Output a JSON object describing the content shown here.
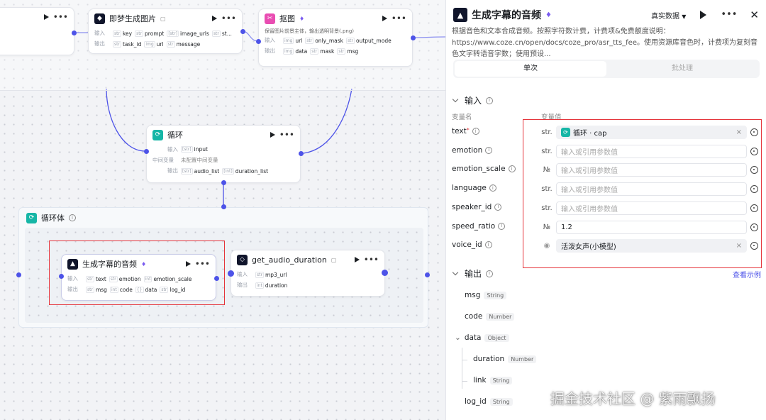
{
  "canvas": {
    "node_top_left": {},
    "node_jimeng": {
      "title": "即梦生成图片",
      "in_label": "输入",
      "out_label": "输出",
      "inputs": [
        {
          "t": "str",
          "n": "key"
        },
        {
          "t": "str",
          "n": "prompt"
        },
        {
          "t": "[str]",
          "n": "image_urls"
        },
        {
          "t": "str",
          "n": "st..."
        }
      ],
      "outputs": [
        {
          "t": "str",
          "n": "task_id"
        },
        {
          "t": "img",
          "n": "url"
        },
        {
          "t": "str",
          "n": "message"
        }
      ]
    },
    "node_koutu": {
      "title": "抠图",
      "desc": "保留图片前景主体，输出透明背景(.png)",
      "in_label": "输入",
      "out_label": "输出",
      "inputs": [
        {
          "t": "img",
          "n": "url"
        },
        {
          "t": "str",
          "n": "only_mask"
        },
        {
          "t": "str",
          "n": "output_mode"
        }
      ],
      "outputs": [
        {
          "t": "img",
          "n": "data"
        },
        {
          "t": "str",
          "n": "mask"
        },
        {
          "t": "str",
          "n": "msg"
        }
      ]
    },
    "node_loop": {
      "title": "循环",
      "in_label": "输入",
      "mid_label": "中间变量",
      "out_label": "输出",
      "input": {
        "t": "[str]",
        "n": "input"
      },
      "mid_value": "未配置中间变量",
      "outputs": [
        {
          "t": "[str]",
          "n": "audio_list"
        },
        {
          "t": "[int]",
          "n": "duration_list"
        }
      ]
    },
    "loop_body": {
      "title": "循环体"
    },
    "node_tts": {
      "title": "生成字幕的音频",
      "in_label": "输入",
      "out_label": "输出",
      "inputs": [
        {
          "t": "str",
          "n": "text"
        },
        {
          "t": "str",
          "n": "emotion"
        },
        {
          "t": "int",
          "n": "emotion_scale"
        }
      ],
      "outputs": [
        {
          "t": "str",
          "n": "msg"
        },
        {
          "t": "int",
          "n": "code"
        },
        {
          "t": "{}",
          "n": "data"
        },
        {
          "t": "str",
          "n": "log_id"
        }
      ]
    },
    "node_duration": {
      "title": "get_audio_duration",
      "in_label": "输入",
      "out_label": "输出",
      "inputs": [
        {
          "t": "str",
          "n": "mp3_url"
        }
      ],
      "outputs": [
        {
          "t": "int",
          "n": "duration"
        }
      ]
    }
  },
  "panel": {
    "title": "生成字幕的音频",
    "mode_select": "真实数据",
    "description": "根据音色和文本合成音频。按照字符数计费，计费项&免费额度说明：https://www.coze.cn/open/docs/coze_pro/asr_tts_fee。使用资源库音色时，计费项为复刻音色文字转语音字数；使用预设...",
    "tabs": [
      "单次",
      "批处理"
    ],
    "input_section": "输入",
    "col_var_name": "变量名",
    "col_var_value": "变量值",
    "placeholder": "输入或引用参数值",
    "params": [
      {
        "name": "text",
        "required": true,
        "type": "str.",
        "mode": "ref",
        "value": "循环 · cap"
      },
      {
        "name": "emotion",
        "type": "str.",
        "mode": "empty",
        "value": ""
      },
      {
        "name": "emotion_scale",
        "type": "№",
        "mode": "empty",
        "value": ""
      },
      {
        "name": "language",
        "type": "str.",
        "mode": "empty",
        "value": ""
      },
      {
        "name": "speaker_id",
        "type": "str.",
        "mode": "empty",
        "value": ""
      },
      {
        "name": "speed_ratio",
        "type": "№",
        "mode": "value",
        "value": "1.2"
      },
      {
        "name": "voice_id",
        "type": "",
        "mode": "voice",
        "value": "活泼女声(小模型)"
      }
    ],
    "output_section": "输出",
    "view_example": "查看示例",
    "outputs": [
      {
        "name": "msg",
        "type": "String"
      },
      {
        "name": "code",
        "type": "Number"
      },
      {
        "name": "data",
        "type": "Object"
      },
      {
        "name": "duration",
        "type": "Number"
      },
      {
        "name": "link",
        "type": "String"
      },
      {
        "name": "log_id",
        "type": "String"
      }
    ]
  },
  "watermark": "掘金技术社区 @ 紫雨飘扬",
  "colors": {
    "accent": "#4d53e8",
    "highlight": "#e5343b",
    "teal": "#16b6a6",
    "pink": "#e94db2"
  }
}
